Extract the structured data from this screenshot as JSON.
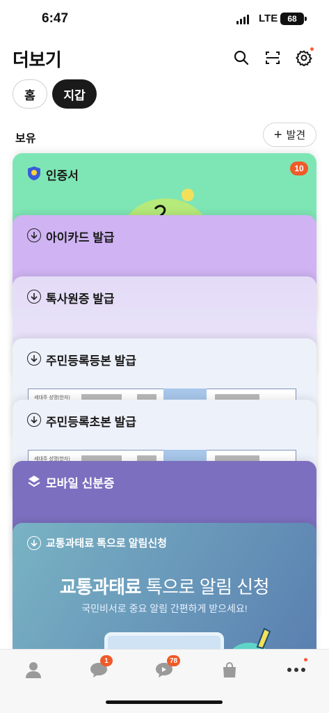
{
  "status_bar": {
    "time": "6:47",
    "network": "LTE",
    "battery": "68"
  },
  "header": {
    "title": "더보기",
    "icons": [
      "search-icon",
      "scan-icon",
      "settings-icon"
    ],
    "tabs": [
      {
        "label": "홈",
        "selected": false
      },
      {
        "label": "지갑",
        "selected": true
      }
    ]
  },
  "section": {
    "title": "보유",
    "issue_button": "발견"
  },
  "cards": {
    "certificate": {
      "title": "인증서",
      "badge": "10",
      "icon": "shield-icon",
      "color": "#7ee6b5"
    },
    "icard": {
      "title": "아이카드 발급",
      "icon": "download-icon",
      "color": "#cfb3f2"
    },
    "tax": {
      "title": "톡사원증 발급",
      "icon": "download-icon"
    },
    "resident_copy": {
      "title": "주민등록등본 발급",
      "icon": "download-icon",
      "doc_label": "세대주 성명(한자)"
    },
    "resident_abstract": {
      "title": "주민등록초본 발급",
      "icon": "download-icon",
      "doc_label": "세대주 성명(한자)"
    },
    "mobile_id": {
      "title": "모바일 신분증",
      "icon": "id-layers-icon",
      "color": "#7c6fbf"
    },
    "traffic": {
      "title": "교통과태료 톡으로 알림신청",
      "headline_bold": "교통과태료",
      "headline_rest": " 톡으로 알림 신청",
      "subtitle": "국민비서로 중요 알림 간편하게 받으세요!"
    }
  },
  "bottom_nav": {
    "items": [
      {
        "icon": "person-icon"
      },
      {
        "icon": "chat-icon",
        "badge": "1"
      },
      {
        "icon": "open-chat-icon",
        "badge": "78"
      },
      {
        "icon": "shopping-bag-icon"
      },
      {
        "icon": "more-icon"
      }
    ]
  }
}
